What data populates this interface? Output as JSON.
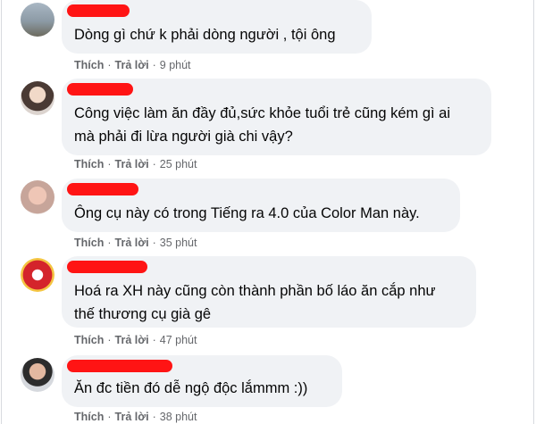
{
  "comments": [
    {
      "text": "Dòng gì chứ k phải dòng người , tội ông",
      "like": "Thích",
      "reply": "Trả lời",
      "time": "9 phút"
    },
    {
      "text": "Công việc làm ăn đầy đủ,sức khỏe tuổi trẻ cũng kém gì ai\nmà phải đi lừa người già chi vậy?",
      "like": "Thích",
      "reply": "Trả lời",
      "time": "25 phút"
    },
    {
      "text": "Ông cụ này có trong Tiếng ra 4.0 của Color Man này.",
      "like": "Thích",
      "reply": "Trả lời",
      "time": "35 phút"
    },
    {
      "text": "Hoá ra XH này cũng còn thành phần bố láo ăn cắp như\nthế thương cụ già gê",
      "like": "Thích",
      "reply": "Trả lời",
      "time": "47 phút"
    },
    {
      "text": "Ăn đc tiền đó dễ ngộ độc lắmmm :))",
      "like": "Thích",
      "reply": "Trả lời",
      "time": "38 phút"
    }
  ],
  "colors": {
    "bubble": "#f0f2f5",
    "meta": "#65676b",
    "redaction": "#ff1414"
  }
}
